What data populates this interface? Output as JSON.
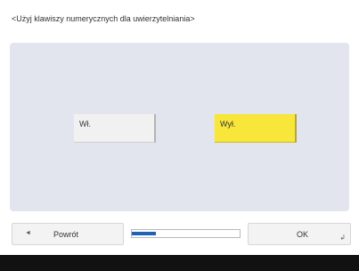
{
  "dialog": {
    "title": "<Użyj klawiszy numerycznych dla uwierzytelniania>"
  },
  "options": {
    "on_label": "Wł.",
    "off_label": "Wył.",
    "selected": "off",
    "selected_color": "#f8e63a"
  },
  "footer": {
    "back_label": "Powrót",
    "back_icon": "left-triangle-icon",
    "ok_label": "OK",
    "ok_icon": "corner-return-icon",
    "progress_fraction": 0.22,
    "progress_color": "#1f62b8"
  }
}
